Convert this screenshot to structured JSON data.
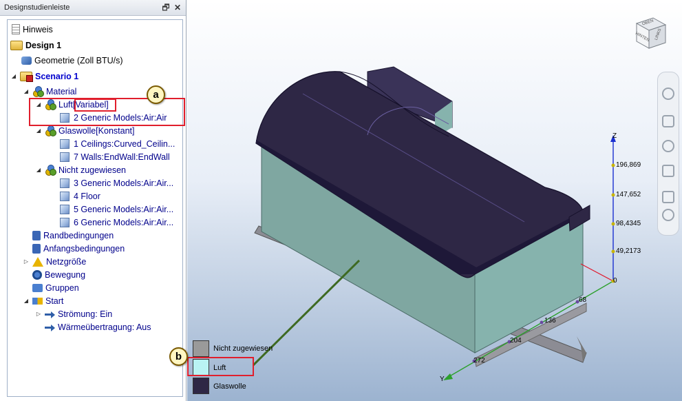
{
  "panel": {
    "title": "Designstudienleiste",
    "restore_icon": "restore-icon",
    "close_icon": "close-icon"
  },
  "tree": {
    "hinweis": "Hinweis",
    "design": "Design 1",
    "geometrie": "Geometrie (Zoll BTU/s)",
    "scenario": "Scenario 1",
    "material": "Material",
    "luft": "Luft",
    "luft_tag": "[Variabel]",
    "luft_item": "2 Generic Models:Air:Air",
    "glaswolle": "Glaswolle[Konstant]",
    "glas_item1": "1 Ceilings:Curved_Ceilin...",
    "glas_item2": "7 Walls:EndWall:EndWall",
    "nicht": "Nicht zugewiesen",
    "nicht_item1": "3 Generic Models:Air:Air...",
    "nicht_item2": "4 Floor",
    "nicht_item3": "5 Generic Models:Air:Air...",
    "nicht_item4": "6 Generic Models:Air:Air...",
    "rand": "Randbedingungen",
    "anfang": "Anfangsbedingungen",
    "netz": "Netzgröße",
    "bewegung": "Bewegung",
    "gruppen": "Gruppen",
    "start": "Start",
    "stroemung": "Strömung: Ein",
    "waerme": "Wärmeübertragung: Aus"
  },
  "callouts": {
    "a": "a",
    "b": "b"
  },
  "legend": {
    "items": [
      {
        "label": "Nicht zugewiesen",
        "color": "#9a9a9a"
      },
      {
        "label": "Luft",
        "color": "#b9f3f3"
      },
      {
        "label": "Glaswolle",
        "color": "#2e2745"
      }
    ]
  },
  "axes": {
    "z_label": "Z",
    "y_label": "Y",
    "z_ticks": [
      "196,869",
      "147,652",
      "98,4345",
      "49,2173",
      "0"
    ],
    "ground_ticks": [
      "68",
      "136",
      "204",
      "272"
    ]
  },
  "viewcube": {
    "face_top": "OBEN",
    "face_front": "HINTEN",
    "face_side": "LINKS"
  },
  "colors": {
    "roof": "#2e2745",
    "wall": "#7fa7a1",
    "highlight_red": "#e01e2c",
    "tree_text": "#00008b"
  }
}
